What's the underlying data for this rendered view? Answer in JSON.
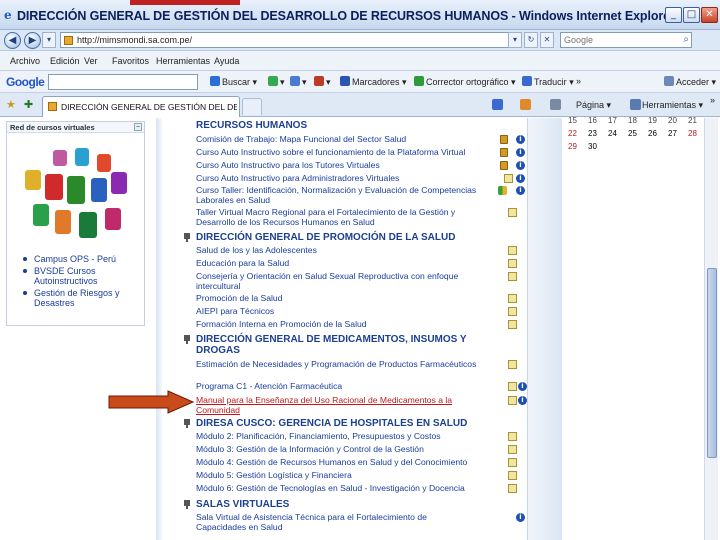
{
  "window": {
    "title": "DIRECCIÓN GENERAL DE GESTIÓN DEL DESARROLLO DE RECURSOS HUMANOS - Windows Internet Explorer",
    "minimize": "_",
    "maximize": "□",
    "close": "✕"
  },
  "address": {
    "url": "http://mimsmondi.sa.com.pe/",
    "search_placeholder": "Google"
  },
  "menu": [
    "Archivo",
    "Edición",
    "Ver",
    "Favoritos",
    "Herramientas",
    "Ayuda"
  ],
  "google_toolbar": {
    "logo": "Google",
    "buscar": "Buscar",
    "marcadores": "Marcadores",
    "corrector": "Corrector ortográfico",
    "traducir": "Traducir",
    "acceder": "Acceder",
    "more": "»"
  },
  "tabs": {
    "active_label": "DIRECCIÓN GENERAL DE GESTIÓN DEL DESA...",
    "pagina": "Página",
    "herramientas": "Herramientas",
    "more": "»"
  },
  "left_panel": {
    "header": "Red de cursos virtuales",
    "links": [
      "Campus OPS - Perú",
      "BVSDE Cursos Autoinstructivos",
      "Gestión de Riesgos y Desastres"
    ]
  },
  "sections": [
    {
      "title": "RECURSOS HUMANOS",
      "courses": [
        "Comisión de Trabajo: Mapa Funcional del Sector Salud",
        "Curso Auto Instructivo sobre el funcionamiento de la Plataforma Virtual",
        "Curso Auto Instructivo para los Tutores Virtuales",
        "Curso Auto Instructivo para Administradores Virtuales",
        "Curso Taller: Identificación, Normalización y Evaluación de Competencias Laborales en Salud",
        "Taller Virtual Macro Regional para el Fortalecimiento de la Gestión y Desarrollo de los Recursos Humanos en Salud"
      ]
    },
    {
      "title": "DIRECCIÓN GENERAL DE PROMOCIÓN DE LA SALUD",
      "courses": [
        "Salud de los y las Adolescentes",
        "Educación para la Salud",
        "Consejería y Orientación en Salud Sexual Reproductiva con enfoque intercultural",
        "Promoción de la Salud",
        "AIEPI para Técnicos",
        "Formación Interna en Promoción de la Salud"
      ]
    },
    {
      "title": "DIRECCIÓN GENERAL DE MEDICAMENTOS, INSUMOS Y DROGAS",
      "courses": [
        "Estimación de Necesidades y Programación de Productos Farmacéuticos",
        "Programa C1 - Atención Farmacéutica",
        "Manual para la Enseñanza del Uso Racional de Medicamentos a la Comunidad"
      ]
    },
    {
      "title": "DIRESA CUSCO: GERENCIA DE HOSPITALES EN SALUD",
      "courses": [
        "Módulo 2: Planificación, Financiamiento, Presupuestos y Costos",
        "Módulo 3: Gestión de la Información y Control de la Gestión",
        "Módulo 4: Gestión de Recursos Humanos en Salud y del Conocimiento",
        "Módulo 5: Gestión Logística y Financiera",
        "Módulo 6: Gestión de Tecnologías en Salud - Investigación y Docencia"
      ]
    },
    {
      "title": "SALAS VIRTUALES",
      "courses": [
        "Sala Virtual de Asistencia Técnica para el Fortalecimiento de Capacidades en Salud"
      ]
    }
  ],
  "calendar": {
    "rows": [
      [
        "15",
        "16",
        "17",
        "18",
        "19",
        "20",
        "21"
      ],
      [
        "22",
        "23",
        "24",
        "25",
        "26",
        "27",
        "28"
      ],
      [
        "29",
        "30"
      ]
    ]
  },
  "colors": {
    "link": "#1a3d9a",
    "section": "#1c3f8f",
    "highlight": "#c0181a",
    "arrow": "#c94a1a"
  }
}
